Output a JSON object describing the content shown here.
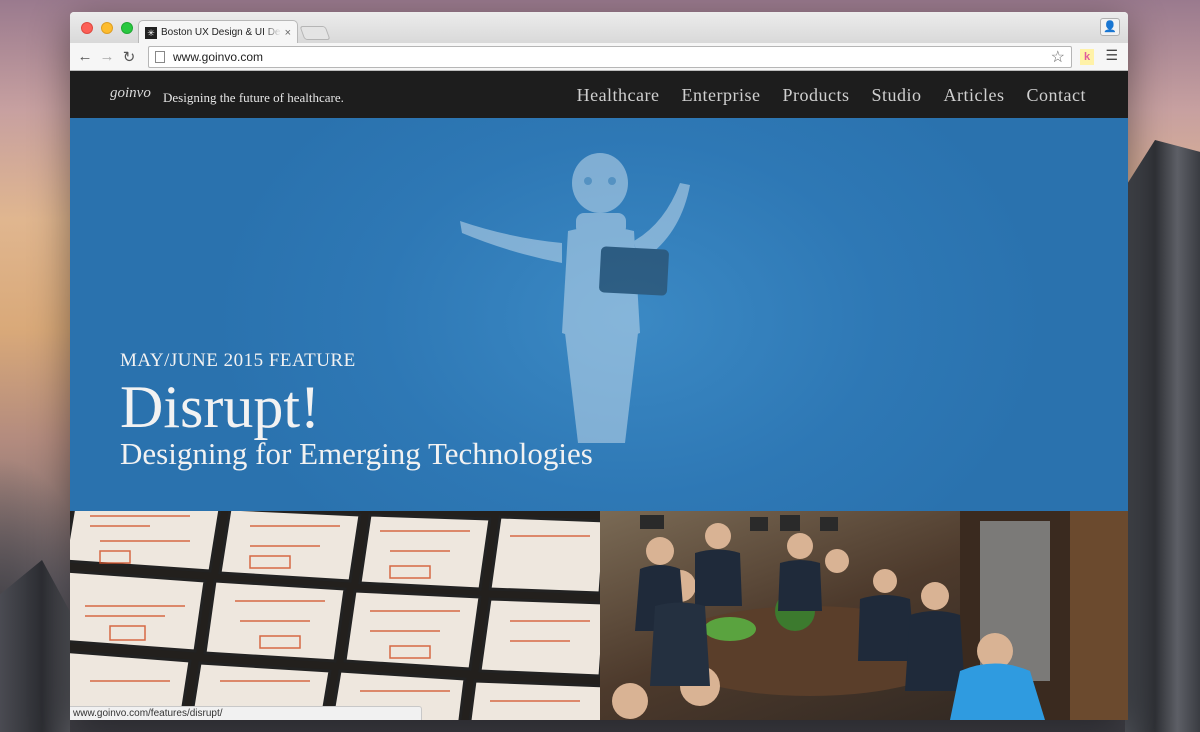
{
  "browser": {
    "tab_title": "Boston UX Design & UI Design",
    "tab_close": "×",
    "url": "www.goinvo.com",
    "status_url": "www.goinvo.com/features/disrupt/"
  },
  "site": {
    "logo": "goinvo",
    "tagline": "Designing the future of healthcare.",
    "nav": [
      "Healthcare",
      "Enterprise",
      "Products",
      "Studio",
      "Articles",
      "Contact"
    ]
  },
  "hero": {
    "kicker": "MAY/JUNE 2015 FEATURE",
    "title": "Disrupt!",
    "subtitle": "Designing for Emerging Technologies"
  },
  "colors": {
    "hero_blue": "#2e78b5",
    "header_black": "#1d1d1d"
  }
}
